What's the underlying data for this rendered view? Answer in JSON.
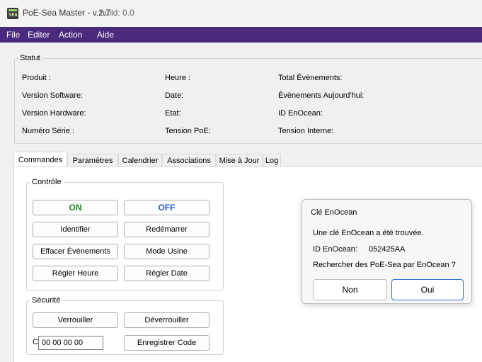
{
  "window": {
    "title": "PoE-Sea Master - v.2.7",
    "build": "build: 0.0",
    "icon_text": "SEA"
  },
  "menu": [
    "File",
    "Editer",
    "Action",
    "Aide"
  ],
  "statut": {
    "legend": "Statut",
    "col1": [
      "Produit :",
      "Version Software:",
      "Version Hardware:",
      "Numéro Série :"
    ],
    "col2": [
      "Heure :",
      "Date:",
      "Etat:",
      "Tension PoE:"
    ],
    "col3": [
      "Total Évènements:",
      "Évènements Aujourd'hui:",
      "ID EnOcean:",
      "Tension Interne:"
    ]
  },
  "tabs": [
    "Commandes",
    "Paramètres",
    "Calendrier",
    "Associations",
    "Mise à Jour",
    "Log"
  ],
  "controle": {
    "legend": "Contrôle",
    "on": "ON",
    "off": "OFF",
    "identifier": "Identifier",
    "redemarrer": "Redémarrer",
    "effacer": "Effacer Évènements",
    "mode_usine": "Mode Usine",
    "regler_heure": "Régler Heure",
    "regler_date": "Régler Date"
  },
  "securite": {
    "legend": "Sécurité",
    "verrouiller": "Verrouiller",
    "deverrouiller": "Déverrouiller",
    "code_label": "Code:",
    "code_value": "00 00 00 00",
    "enregistrer": "Enregistrer Code"
  },
  "dialog": {
    "title": "Clé EnOcean",
    "message": "Une clé EnOcean a été trouvée.",
    "id_label": "ID EnOcean:",
    "id_value": "052425AA",
    "question": "Rechercher des PoE-Sea par EnOcean ?",
    "no": "Non",
    "yes": "Oui"
  },
  "colors": {
    "menubar": "#4a2a7c",
    "on": "#1e8a1e",
    "off": "#1f5ec9",
    "dialog_primary_border": "#2a6fd4"
  }
}
